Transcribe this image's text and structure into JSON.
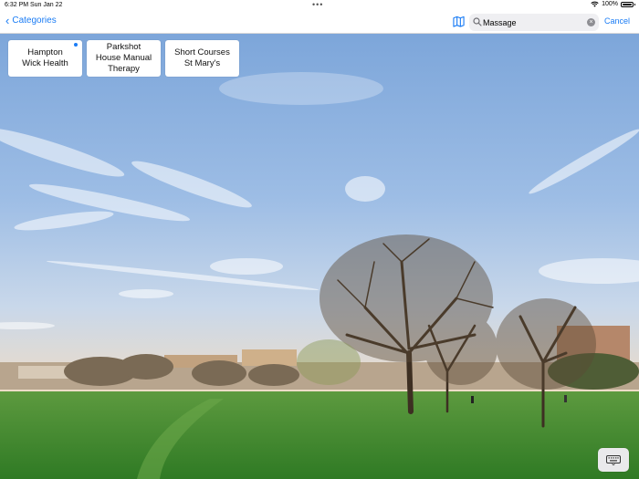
{
  "status_bar": {
    "time": "6:32 PM",
    "date": "Sun Jan 22",
    "battery": "100%",
    "battery_level": 1.0
  },
  "nav": {
    "back_label": "Categories",
    "search": {
      "value": "Massage",
      "placeholder": "Search"
    },
    "cancel_label": "Cancel"
  },
  "results": [
    {
      "line1": "Hampton",
      "line2": "Wick Health",
      "line3": "",
      "selected": true
    },
    {
      "line1": "Parkshot",
      "line2": "House Manual",
      "line3": "Therapy",
      "selected": false
    },
    {
      "line1": "Short Courses",
      "line2": "St Mary's",
      "line3": "",
      "selected": false
    }
  ],
  "icons": {
    "back": "chevron-left-icon",
    "map": "map-icon",
    "search": "search-icon",
    "clear": "clear-icon",
    "keyboard": "keyboard-icon",
    "wifi": "wifi-icon",
    "battery": "battery-icon"
  },
  "colors": {
    "accent": "#1a7cf5",
    "sky_top": "#7fa8dc",
    "grass": "#3f8a2e"
  }
}
